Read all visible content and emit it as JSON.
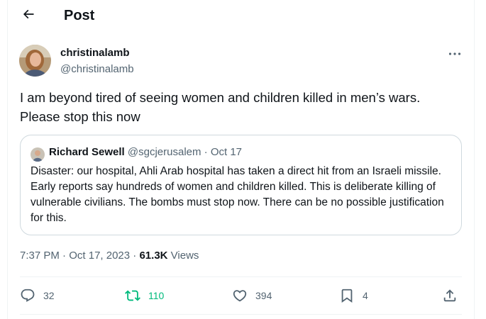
{
  "header": {
    "title": "Post",
    "back_icon": "arrow-left-icon"
  },
  "author": {
    "display_name": "christinalamb",
    "handle": "@christinalamb"
  },
  "tweet": {
    "text_line1": "I am beyond tired of seeing women and children killed in men’s wars.",
    "text_line2": "Please stop this now"
  },
  "quoted": {
    "display_name": "Richard Sewell",
    "handle": "@sgcjerusalem",
    "separator": "·",
    "date": "Oct 17",
    "text": "Disaster: our hospital, Ahli Arab hospital has taken a direct hit from an Israeli missile. Early reports say hundreds of women and children killed. This is deliberate killing of vulnerable civilians. The bombs must stop now. There can be no possible justification for this."
  },
  "meta": {
    "time": "7:37 PM",
    "separator": "·",
    "date": "Oct 17, 2023",
    "views_count": "61.3K",
    "views_label": "Views"
  },
  "actions": {
    "replies": "32",
    "reposts": "110",
    "likes": "394",
    "bookmarks": "4"
  },
  "colors": {
    "text": "#0f1419",
    "secondary": "#536471",
    "repost_active": "#00ba7c",
    "border": "#cfd9de",
    "divider": "#eff3f4"
  }
}
